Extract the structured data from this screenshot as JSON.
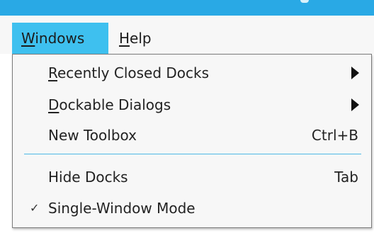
{
  "titlebar": {
    "accent_color": "#29a9e5"
  },
  "menubar": {
    "windows": {
      "first": "W",
      "rest": "indows"
    },
    "help": {
      "first": "H",
      "rest": "elp"
    }
  },
  "menu": {
    "items": [
      {
        "mnemonic": "R",
        "rest": "ecently Closed Docks",
        "submenu": true,
        "icon": "chevron-right-icon"
      },
      {
        "mnemonic": "D",
        "rest": "ockable Dialogs",
        "submenu": true,
        "icon": "chevron-right-icon"
      },
      {
        "label": "New Toolbox",
        "shortcut": "Ctrl+B"
      },
      {
        "label": "Hide Docks",
        "shortcut": "Tab"
      },
      {
        "label": "Single-Window Mode",
        "checked": true,
        "check_glyph": "✓",
        "icon": "checkmark-icon"
      }
    ],
    "highlight_color": "#3ec0ef",
    "separator_color": "#4cb8e6"
  }
}
